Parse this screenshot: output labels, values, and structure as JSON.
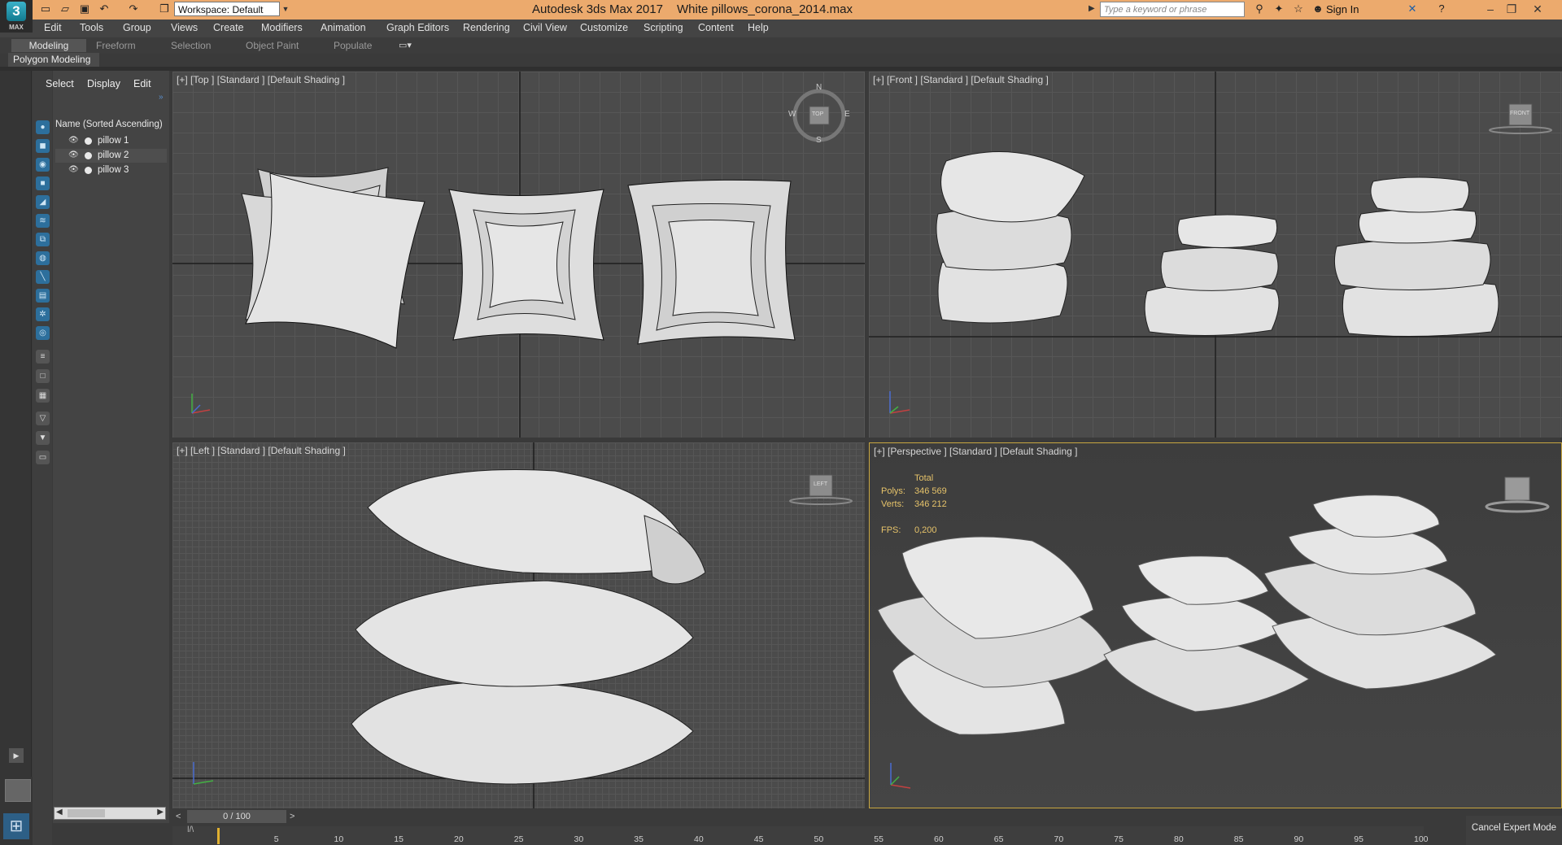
{
  "app": {
    "logo": "3",
    "logo_sub": "MAX",
    "title": "Autodesk 3ds Max 2017",
    "file": "White pillows_corona_2014.max"
  },
  "quick_access": {
    "workspace": "Workspace: Default"
  },
  "search": {
    "placeholder": "Type a keyword or phrase"
  },
  "account": {
    "signin": "Sign In"
  },
  "menu": [
    "Edit",
    "Tools",
    "Group",
    "Views",
    "Create",
    "Modifiers",
    "Animation",
    "Graph Editors",
    "Rendering",
    "Civil View",
    "Customize",
    "Scripting",
    "Content",
    "Help"
  ],
  "ribbon": {
    "tabs": [
      "Modeling",
      "Freeform",
      "Selection",
      "Object Paint",
      "Populate"
    ],
    "panel": "Polygon Modeling"
  },
  "scene_explorer": {
    "tabs": [
      "Select",
      "Display",
      "Edit"
    ],
    "column_header": "Name (Sorted Ascending)",
    "objects": [
      "pillow 1",
      "pillow 2",
      "pillow 3"
    ]
  },
  "viewports": {
    "top": {
      "label": "[+] [Top ] [Standard ] [Default Shading ]",
      "compass": [
        "N",
        "E",
        "S",
        "W"
      ],
      "cube": "TOP"
    },
    "front": {
      "label": "[+] [Front ] [Standard ] [Default Shading ]",
      "cube": "FRONT"
    },
    "left": {
      "label": "[+] [Left ] [Standard ] [Default Shading ]",
      "cube": "LEFT"
    },
    "perspective": {
      "label": "[+] [Perspective ] [Standard ] [Default Shading ]",
      "stats": {
        "total_label": "Total",
        "polys_label": "Polys:",
        "polys": "346 569",
        "verts_label": "Verts:",
        "verts": "346 212",
        "fps_label": "FPS:",
        "fps": "0,200"
      }
    }
  },
  "timeline": {
    "frame": "0 / 100",
    "ticks": [
      "5",
      "10",
      "15",
      "20",
      "25",
      "30",
      "35",
      "40",
      "45",
      "50",
      "55",
      "60",
      "65",
      "70",
      "75",
      "80",
      "85",
      "90",
      "95",
      "100"
    ]
  },
  "expert_mode": {
    "cancel": "Cancel Expert Mode"
  },
  "colors": {
    "title_bar": "#ecaa6d",
    "accent": "#c8a640",
    "viewport_bg": "#4b4b4b",
    "pillow": "#e6e6e6"
  },
  "icons": [
    "new-file-icon",
    "open-file-icon",
    "save-icon",
    "undo-icon",
    "redo-icon",
    "project-folder-icon",
    "binoculars-icon",
    "star-icon",
    "user-icon",
    "help-icon"
  ]
}
